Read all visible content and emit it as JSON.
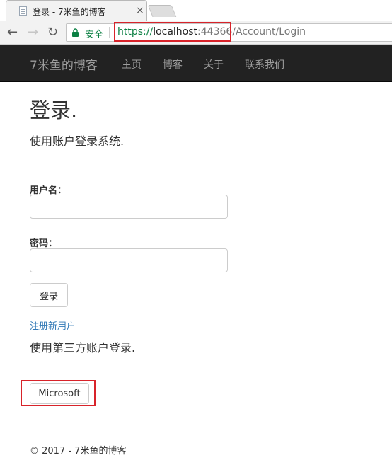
{
  "browser": {
    "tab": {
      "title": "登录 - 7米鱼的博客",
      "close": "×"
    },
    "nav": {
      "back": "←",
      "forward": "→",
      "reload": "↻"
    },
    "address": {
      "security_label": "安全",
      "scheme": "https://",
      "host": "localhost",
      "port": ":44366",
      "path": "/Account/Login"
    },
    "colors": {
      "secure": "#0b8043",
      "annotation": "#d8232a"
    }
  },
  "navbar": {
    "brand": "7米鱼的博客",
    "links": [
      "主页",
      "博客",
      "关于",
      "联系我们"
    ],
    "background": "#222222"
  },
  "page": {
    "title": "登录.",
    "subtitle": "使用账户登录系统.",
    "username_label": "用户名：",
    "username_value": "",
    "password_label": "密码：",
    "password_value": "",
    "login_button": "登录",
    "register_link": "注册新用户",
    "external_login_heading": "使用第三方账户登录.",
    "external_providers": [
      "Microsoft"
    ],
    "link_color": "#337ab7"
  },
  "footer": {
    "text": "© 2017 - 7米鱼的博客"
  }
}
